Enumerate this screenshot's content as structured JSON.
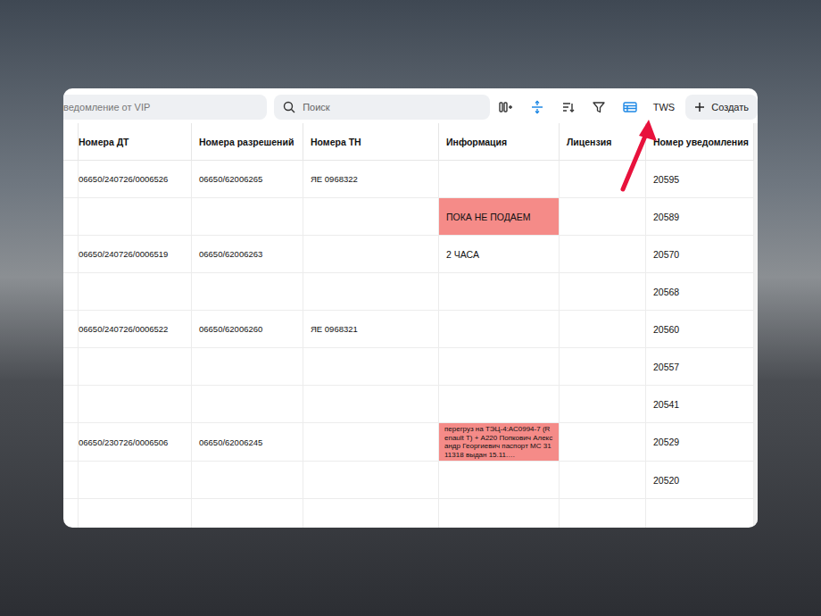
{
  "toolbar": {
    "filter_field": "ведомление от VIP",
    "search_placeholder": "Поиск",
    "tools": [
      {
        "kind": "columns",
        "active": false
      },
      {
        "kind": "row-height",
        "active": true
      },
      {
        "kind": "sort",
        "active": false
      },
      {
        "kind": "filter",
        "active": false
      },
      {
        "kind": "table",
        "active": true
      }
    ],
    "tws": "TWS",
    "create": "Создать"
  },
  "table": {
    "columns": [
      "",
      "Номера ДТ",
      "Номера разрешений",
      "Номера ТН",
      "Информация",
      "Лицензия",
      "Номер уведомления"
    ],
    "rows": [
      {
        "dt": "06650/240726/0006526",
        "permits": "06650/62006265",
        "tn": "ЯЕ 0968322",
        "info": {
          "text": "",
          "highlighted": false,
          "kind": "short"
        },
        "license": "",
        "notice": "20595"
      },
      {
        "dt": "",
        "permits": "",
        "tn": "",
        "info": {
          "text": "ПОКА НЕ ПОДАЕМ",
          "highlighted": true,
          "kind": "short"
        },
        "license": "",
        "notice": "20589"
      },
      {
        "dt": "06650/240726/0006519",
        "permits": "06650/62006263",
        "tn": "",
        "info": {
          "text": "2 ЧАСА",
          "highlighted": false,
          "kind": "short"
        },
        "license": "",
        "notice": "20570"
      },
      {
        "dt": "",
        "permits": "",
        "tn": "",
        "info": {
          "text": "",
          "highlighted": false,
          "kind": "short"
        },
        "license": "",
        "notice": "20568"
      },
      {
        "dt": "06650/240726/0006522",
        "permits": "06650/62006260",
        "tn": "ЯЕ 0968321",
        "info": {
          "text": "",
          "highlighted": false,
          "kind": "short"
        },
        "license": "",
        "notice": "20560"
      },
      {
        "dt": "",
        "permits": "",
        "tn": "",
        "info": {
          "text": "",
          "highlighted": false,
          "kind": "short"
        },
        "license": "",
        "notice": "20557"
      },
      {
        "dt": "",
        "permits": "",
        "tn": "",
        "info": {
          "text": "",
          "highlighted": false,
          "kind": "short"
        },
        "license": "",
        "notice": "20541"
      },
      {
        "dt": "06650/230726/0006506",
        "permits": "06650/62006245",
        "tn": "",
        "info": {
          "text": "перегруз на ТЭЦ-4:АС0994-7 (Renault T) + А220 Попкович Александр Георгиевич паспорт МС 3111318 выдан 15.11.…",
          "highlighted": true,
          "kind": "long"
        },
        "license": "",
        "notice": "20529"
      },
      {
        "dt": "",
        "permits": "",
        "tn": "",
        "info": {
          "text": "",
          "highlighted": false,
          "kind": "short"
        },
        "license": "",
        "notice": "20520"
      },
      {
        "dt": "",
        "permits": "",
        "tn": "",
        "info": {
          "text": "",
          "highlighted": false,
          "kind": "short"
        },
        "license": "",
        "notice": ""
      }
    ]
  }
}
